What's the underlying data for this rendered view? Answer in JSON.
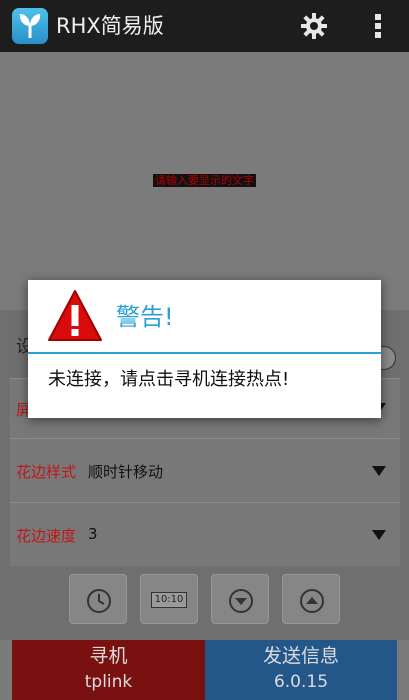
{
  "app": {
    "title": "RHX简易版",
    "icon": "app-leaf-icon"
  },
  "actionbar": {
    "settings_icon": "gear-icon",
    "menu_icon": "overflow-menu-icon"
  },
  "preview": {
    "text": "请输入要显示的文字"
  },
  "settings": {
    "row1_label": "设",
    "row2_label": "屏",
    "border_style": {
      "label": "花边样式",
      "value": "顺时针移动"
    },
    "border_speed": {
      "label": "花边速度",
      "value": "3"
    }
  },
  "toolbar": {
    "clock_label": "10:10"
  },
  "buttons": {
    "find": {
      "title": "寻机",
      "subtitle": "tplink"
    },
    "send": {
      "title": "发送信息",
      "subtitle": "6.0.15"
    }
  },
  "dialog": {
    "title": "警告!",
    "message": "未连接，请点击寻机连接热点!",
    "icon": "warning-icon"
  },
  "colors": {
    "accent": "#2aa0d8",
    "label_red": "#c01818",
    "find_button": "#7a1111",
    "send_button": "#23578a"
  }
}
